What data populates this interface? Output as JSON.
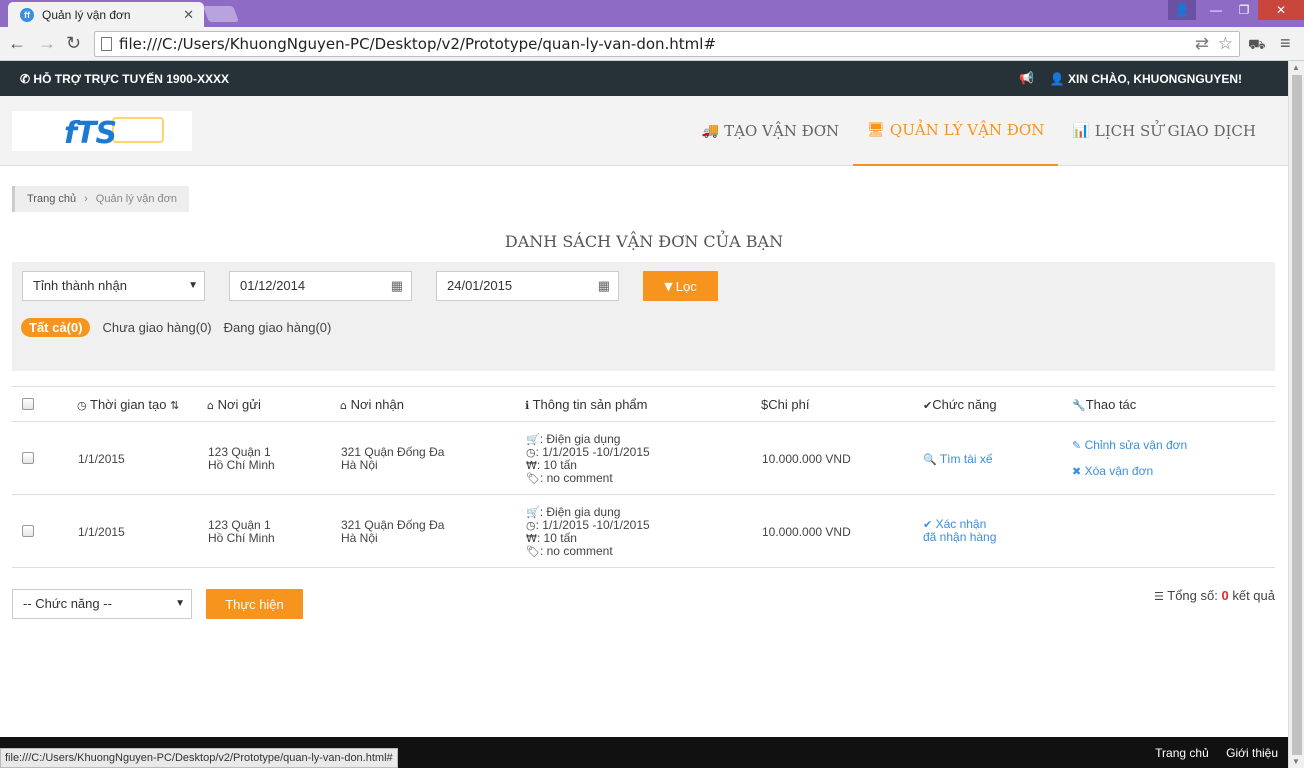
{
  "browser": {
    "tab_title": "Quản lý vận đơn",
    "favicon": "ff",
    "url": "file:///C:/Users/KhuongNguyen-PC/Desktop/v2/Prototype/quan-ly-van-don.html#",
    "status_url": "file:///C:/Users/KhuongNguyen-PC/Desktop/v2/Prototype/quan-ly-van-don.html#"
  },
  "topbar": {
    "support": "HỖ TRỢ TRỰC TUYẾN 1900-XXXX",
    "greeting": "XIN CHÀO, KHUONGNGUYEN!"
  },
  "logo": {
    "text": "fTS"
  },
  "menu": {
    "create": "TẠO VẬN ĐƠN",
    "manage": "QUẢN LÝ VẬN ĐƠN",
    "history": "LỊCH SỬ GIAO DỊCH"
  },
  "breadcrumb": {
    "home": "Trang chủ",
    "current": "Quản lý vận đơn"
  },
  "page_title": "DANH SÁCH VẬN ĐƠN CỦA BẠN",
  "filter": {
    "province": "Tỉnh thành nhận",
    "date_from": "01/12/2014",
    "date_to": "24/01/2015",
    "filter_button": "Lọc",
    "tabs": {
      "all": "Tất cả(0)",
      "pending": "Chưa giao hàng(0)",
      "shipping": "Đang giao hàng(0)"
    }
  },
  "table": {
    "headers": {
      "time": "Thời gian tạo",
      "from": "Nơi gửi",
      "to": "Nơi nhận",
      "product": "Thông tin sản phẩm",
      "cost": "Chi phí",
      "function": "Chức năng",
      "action": "Thao tác"
    },
    "rows": [
      {
        "time": "1/1/2015",
        "from_line1": "123 Quận 1",
        "from_line2": "Hồ Chí Minh",
        "to_line1": "321 Quận Đống Đa",
        "to_line2": "Hà Nội",
        "product_type": ": Điện gia dụng",
        "product_time": ": 1/1/2015  -10/1/2015",
        "product_weight": ": 10 tấn",
        "product_note": ": no comment",
        "cost": "10.000.000 VND",
        "function": "Tìm tài xế",
        "edit": "Chỉnh sửa vận đơn",
        "delete": "Xóa vận đơn"
      },
      {
        "time": "1/1/2015",
        "from_line1": "123 Quận 1",
        "from_line2": "Hồ Chí Minh",
        "to_line1": "321 Quận Đống Đa",
        "to_line2": "Hà Nội",
        "product_type": ": Điện gia dụng",
        "product_time": ": 1/1/2015  -10/1/2015",
        "product_weight": ": 10 tấn",
        "product_note": ": no comment",
        "cost": "10.000.000 VND",
        "function_line1": "Xác nhận",
        "function_line2": "đã nhận hàng"
      }
    ]
  },
  "bulk": {
    "select": "-- Chức năng --",
    "execute": "Thực hiện",
    "total_label": "Tổng số:",
    "total_count": "0",
    "total_suffix": "kết quả"
  },
  "footer": {
    "home": "Trang chủ",
    "about": "Giới thiệu"
  },
  "colors": {
    "accent": "#f7941d",
    "link": "#3a8ee0",
    "topbar": "#263238"
  }
}
